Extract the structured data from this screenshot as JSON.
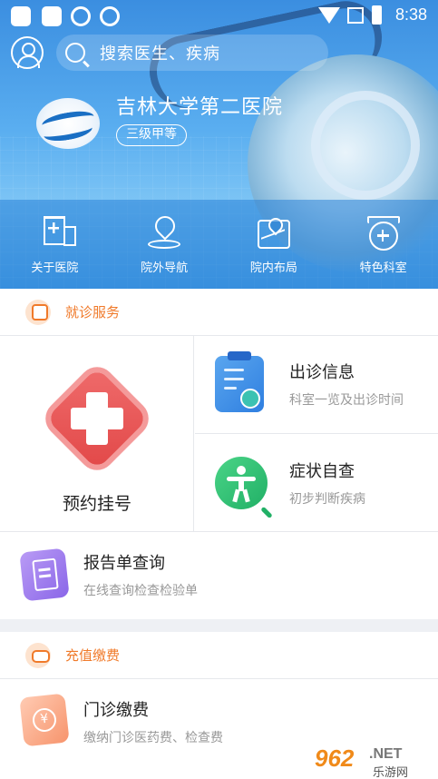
{
  "statusbar": {
    "time": "8:38"
  },
  "search": {
    "placeholder": "搜索医生、疾病"
  },
  "hospital": {
    "name": "吉林大学第二医院",
    "level": "三级甲等"
  },
  "quick_nav": [
    {
      "label": "关于医院",
      "icon": "hospital-building-icon"
    },
    {
      "label": "院外导航",
      "icon": "location-pin-icon"
    },
    {
      "label": "院内布局",
      "icon": "map-icon"
    },
    {
      "label": "特色科室",
      "icon": "department-icon"
    }
  ],
  "visit_section": {
    "title": "就诊服务",
    "appointment": {
      "label": "预约挂号"
    },
    "clinic_info": {
      "title": "出诊信息",
      "subtitle": "科室一览及出诊时间"
    },
    "symptom_check": {
      "title": "症状自查",
      "subtitle": "初步判断疾病"
    },
    "report": {
      "title": "报告单查询",
      "subtitle": "在线查询检查检验单"
    }
  },
  "payment_section": {
    "title": "充值缴费",
    "outpatient": {
      "title": "门诊缴费",
      "subtitle": "缴纳门诊医药费、检查费",
      "coin_symbol": "¥"
    }
  },
  "watermark": {
    "number": "962",
    "domain": ".NET",
    "text": "乐游网"
  },
  "colors": {
    "accent_orange": "#f07a2a",
    "hero_blue": "#3b8ee0"
  }
}
